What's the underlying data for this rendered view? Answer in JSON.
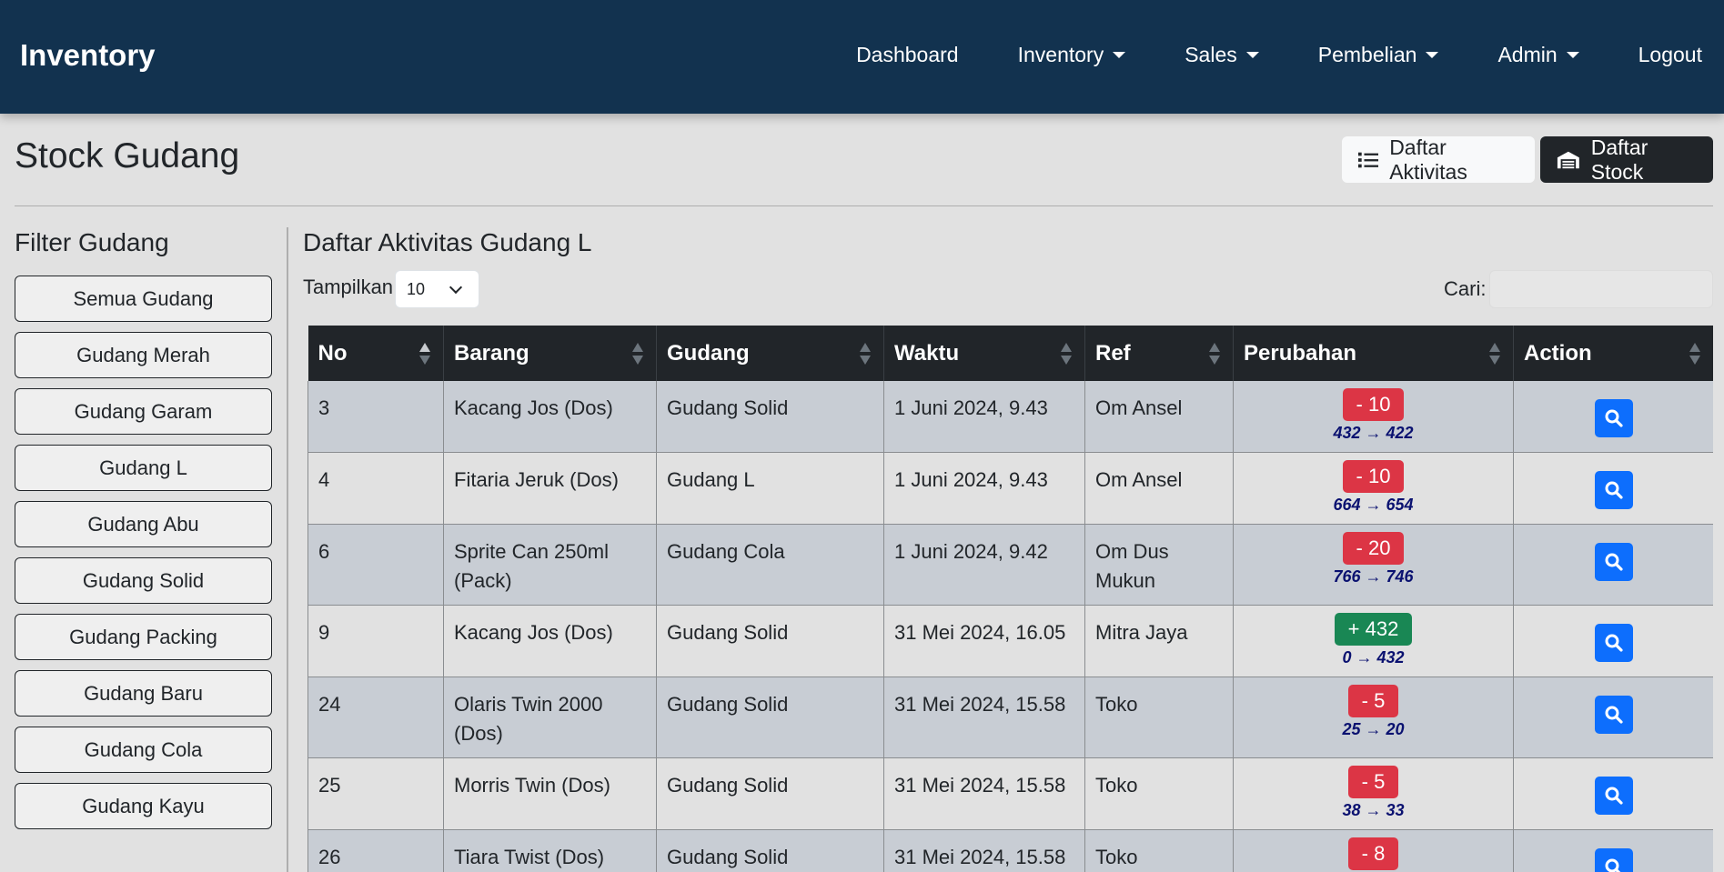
{
  "navbar": {
    "brand": "Inventory",
    "items": [
      {
        "label": "Dashboard",
        "dropdown": false
      },
      {
        "label": "Inventory",
        "dropdown": true
      },
      {
        "label": "Sales",
        "dropdown": true
      },
      {
        "label": "Pembelian",
        "dropdown": true
      },
      {
        "label": "Admin",
        "dropdown": true
      },
      {
        "label": "Logout",
        "dropdown": false
      }
    ]
  },
  "header": {
    "title": "Stock Gudang",
    "btn_aktivitas": "Daftar Aktivitas",
    "btn_stock": "Daftar Stock"
  },
  "sidebar": {
    "title": "Filter Gudang",
    "items": [
      "Semua Gudang",
      "Gudang Merah",
      "Gudang Garam",
      "Gudang L",
      "Gudang Abu",
      "Gudang Solid",
      "Gudang Packing",
      "Gudang Baru",
      "Gudang Cola",
      "Gudang Kayu"
    ]
  },
  "main": {
    "title": "Daftar Aktivitas Gudang L",
    "show_label": "Tampilkan",
    "page_size": "10",
    "search_label": "Cari:",
    "search_value": ""
  },
  "table": {
    "columns": [
      "No",
      "Barang",
      "Gudang",
      "Waktu",
      "Ref",
      "Perubahan",
      "Action"
    ],
    "sorted_column": "No",
    "rows": [
      {
        "no": "3",
        "barang": "Kacang Jos (Dos)",
        "gudang": "Gudang Solid",
        "waktu": "1 Juni 2024, 9.43",
        "ref": "Om Ansel",
        "perubahan": "- 10",
        "type": "minus",
        "delta": "432 → 422"
      },
      {
        "no": "4",
        "barang": "Fitaria Jeruk (Dos)",
        "gudang": "Gudang L",
        "waktu": "1 Juni 2024, 9.43",
        "ref": "Om Ansel",
        "perubahan": "- 10",
        "type": "minus",
        "delta": "664 → 654"
      },
      {
        "no": "6",
        "barang": "Sprite Can 250ml (Pack)",
        "gudang": "Gudang Cola",
        "waktu": "1 Juni 2024, 9.42",
        "ref": "Om Dus Mukun",
        "perubahan": "- 20",
        "type": "minus",
        "delta": "766 → 746"
      },
      {
        "no": "9",
        "barang": "Kacang Jos (Dos)",
        "gudang": "Gudang Solid",
        "waktu": "31 Mei 2024, 16.05",
        "ref": "Mitra Jaya",
        "perubahan": "+ 432",
        "type": "plus",
        "delta": "0 → 432"
      },
      {
        "no": "24",
        "barang": "Olaris Twin 2000 (Dos)",
        "gudang": "Gudang Solid",
        "waktu": "31 Mei 2024, 15.58",
        "ref": "Toko",
        "perubahan": "- 5",
        "type": "minus",
        "delta": "25 → 20"
      },
      {
        "no": "25",
        "barang": "Morris Twin (Dos)",
        "gudang": "Gudang Solid",
        "waktu": "31 Mei 2024, 15.58",
        "ref": "Toko",
        "perubahan": "- 5",
        "type": "minus",
        "delta": "38 → 33"
      },
      {
        "no": "26",
        "barang": "Tiara Twist (Dos)",
        "gudang": "Gudang Solid",
        "waktu": "31 Mei 2024, 15.58",
        "ref": "Toko",
        "perubahan": "- 8",
        "type": "minus",
        "delta": ""
      }
    ]
  },
  "colors": {
    "navbar": "#12324f",
    "minus_badge": "#dc3545",
    "plus_badge": "#198754",
    "action_button": "#0d6efd",
    "delta_text": "#0a1170"
  },
  "icons": {
    "aktivitas": "list-icon",
    "stock": "warehouse-icon",
    "action": "search-icon"
  }
}
